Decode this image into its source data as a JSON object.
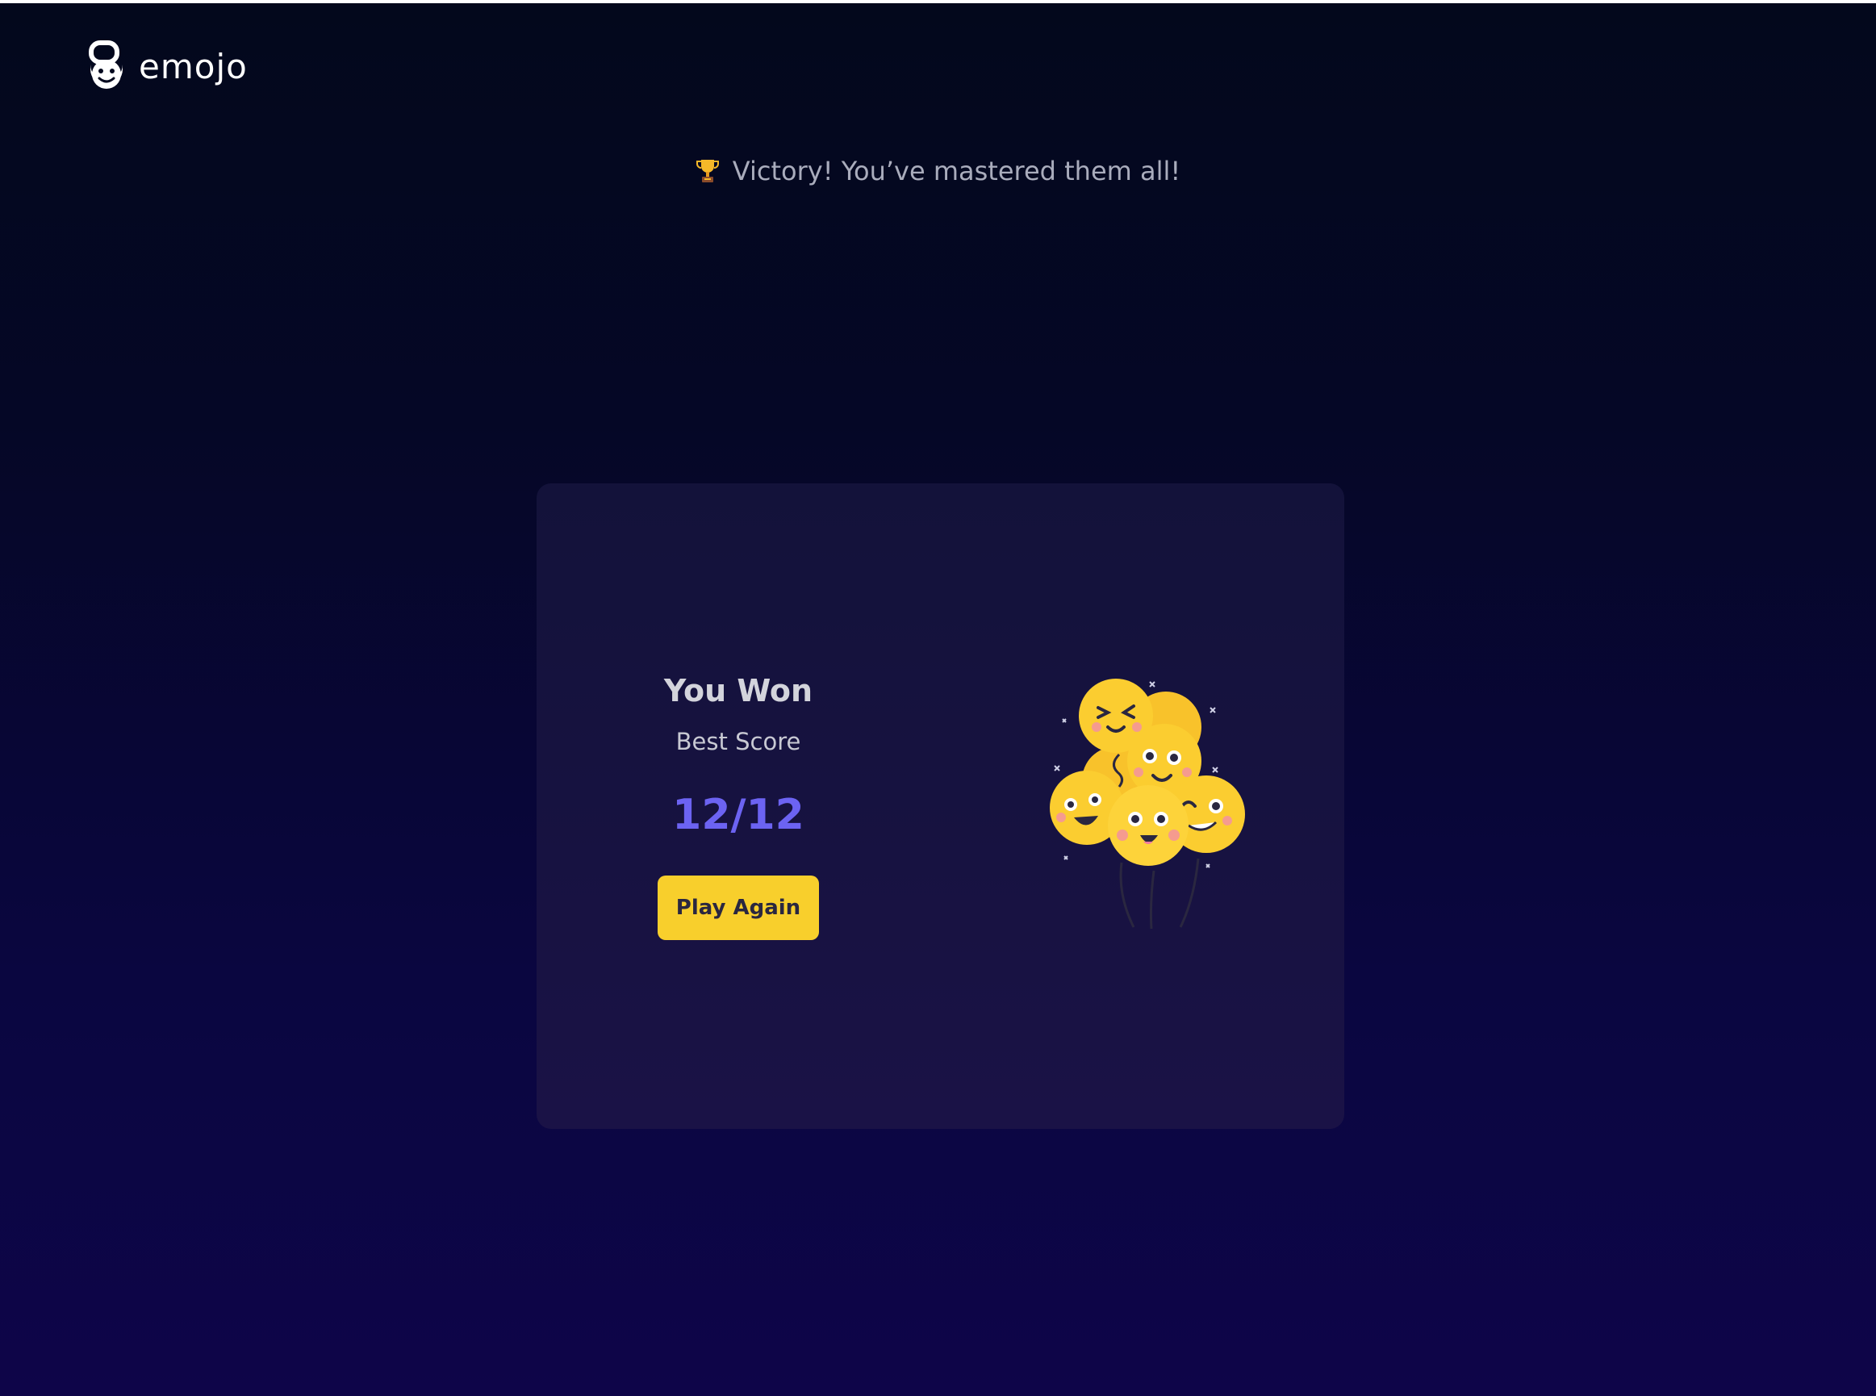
{
  "app": {
    "logo_text": "emojo",
    "logo_icon": "emojo-logo-icon"
  },
  "banner": {
    "icon": "trophy-icon",
    "text": "Victory! You’ve mastered them all!"
  },
  "result": {
    "title": "You Won",
    "subtitle": "Best Score",
    "score": "12/12",
    "play_again_label": "Play Again",
    "illustration": "emoji-balloons-illustration"
  },
  "colors": {
    "accent": "#6c63f2",
    "button": "#f8cf2c",
    "emoji": "#fdc72a"
  }
}
